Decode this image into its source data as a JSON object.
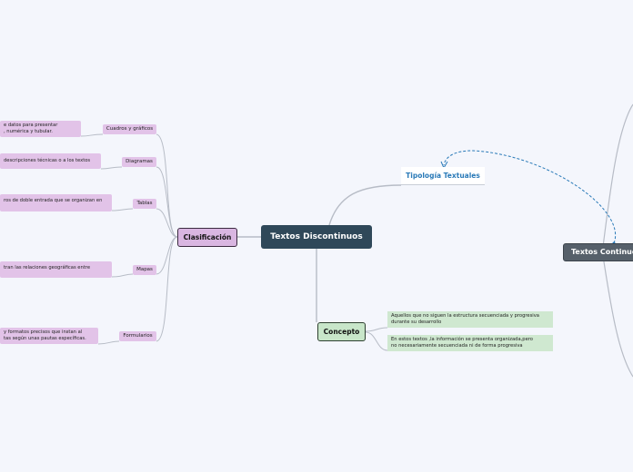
{
  "central": {
    "label": "Textos Discontinuos"
  },
  "main_right": {
    "label": "Textos Continuos"
  },
  "tipologia": {
    "label": "Tipología Textuales"
  },
  "clasificacion": {
    "label": "Clasificación",
    "items": [
      {
        "label": "Cuadros y gráficos",
        "desc_lines": [
          "e datos para presentar",
          ", numérica y tubular."
        ]
      },
      {
        "label": "Diagramas",
        "desc_lines": [
          "descripciones técnicas o a los textos"
        ]
      },
      {
        "label": "Tablas",
        "desc_lines": [
          "ros de doble entrada que se organizan en"
        ]
      },
      {
        "label": "Mapas",
        "desc_lines": [
          "tran las relaciones geográficas entre"
        ]
      },
      {
        "label": "Formularios",
        "desc_lines": [
          "y formatos precisos que instan al",
          "tas según unas pautas específicas."
        ]
      }
    ]
  },
  "concepto": {
    "label": "Concepto",
    "items": [
      {
        "lines": [
          "Aquellos que no siguen la estructura secuenciada y progresiva",
          "durante su desarrollo"
        ]
      },
      {
        "lines": [
          "En estos textos  ,la información se presenta  organizada,pero",
          "no necesariamente  secuenciada ni de forma progresiva"
        ]
      }
    ]
  },
  "colors": {
    "central": "#2f4859",
    "purple": "#d9b6e1",
    "green": "#c8e6c9",
    "link": "#2a7ab8"
  }
}
